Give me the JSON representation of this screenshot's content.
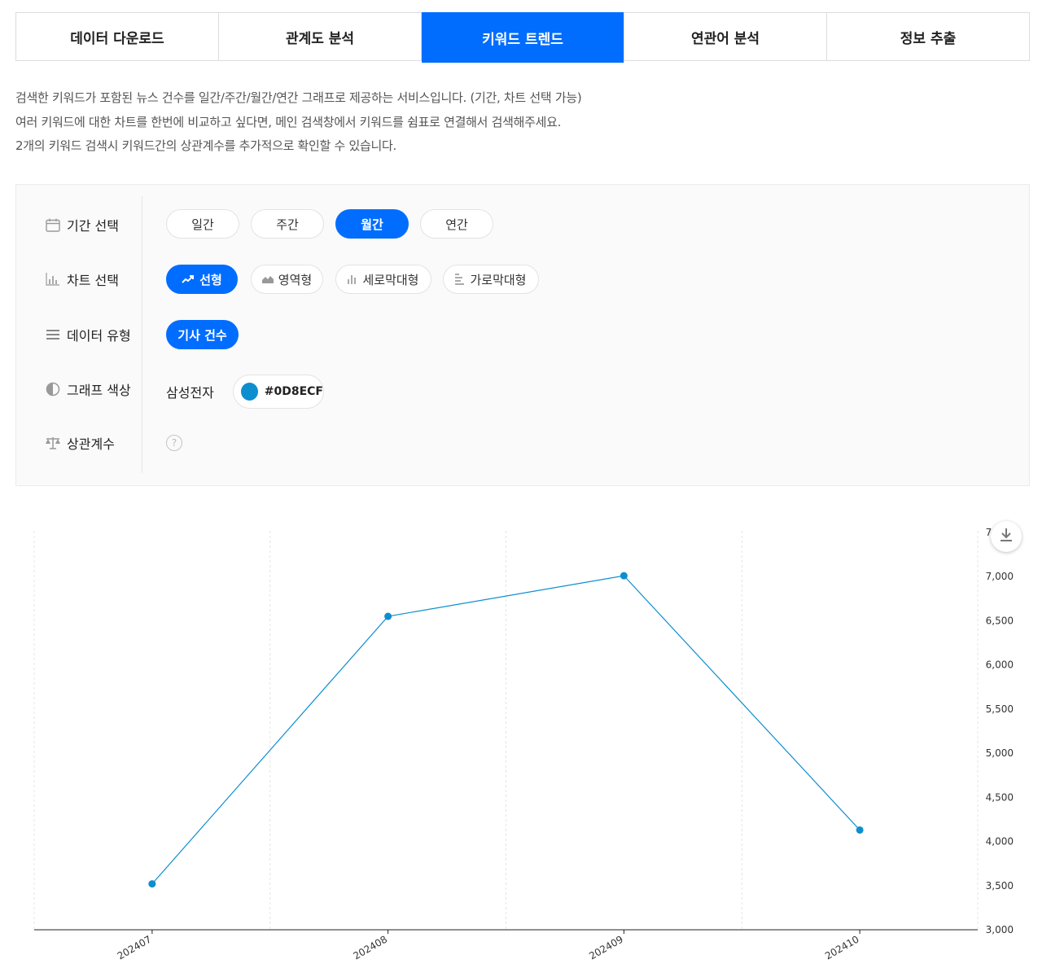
{
  "tabs": [
    {
      "label": "데이터 다운로드",
      "active": false
    },
    {
      "label": "관계도 분석",
      "active": false
    },
    {
      "label": "키워드 트렌드",
      "active": true
    },
    {
      "label": "연관어 분석",
      "active": false
    },
    {
      "label": "정보 추출",
      "active": false
    }
  ],
  "description": [
    "검색한 키워드가 포함된 뉴스 건수를 일간/주간/월간/연간 그래프로 제공하는 서비스입니다. (기간, 차트 선택 가능)",
    "여러 키워드에 대한 차트를 한번에 비교하고 싶다면, 메인 검색창에서 키워드를 쉼표로 연결해서 검색해주세요.",
    "2개의 키워드 검색시 키워드간의 상관계수를 추가적으로 확인할 수 있습니다."
  ],
  "options": {
    "period": {
      "label": "기간 선택",
      "items": [
        "일간",
        "주간",
        "월간",
        "연간"
      ],
      "selected": 2
    },
    "chart": {
      "label": "차트 선택",
      "items": [
        "선형",
        "영역형",
        "세로막대형",
        "가로막대형"
      ],
      "selected": 0
    },
    "data_type": {
      "label": "데이터 유형",
      "items": [
        "기사 건수"
      ],
      "selected": 0
    },
    "color": {
      "label": "그래프 색상",
      "keyword": "삼성전자",
      "hex": "#0D8ECF",
      "hex_label": "#0D8ECF"
    },
    "correlation": {
      "label": "상관계수",
      "help": "?"
    }
  },
  "colors": {
    "accent": "#006dff",
    "series": "#0D8ECF"
  },
  "chart_data": {
    "type": "line",
    "categories": [
      "202407",
      "202408",
      "202409",
      "202410"
    ],
    "series": [
      {
        "values": [
          3520,
          6550,
          7010,
          4130
        ]
      }
    ],
    "ylim": [
      3000,
      7500
    ],
    "yticks": [
      3000,
      3500,
      4000,
      4500,
      5000,
      5500,
      6000,
      6500,
      7000,
      7500
    ],
    "ytick_labels": [
      "3,000",
      "3,500",
      "4,000",
      "4,500",
      "5,000",
      "5,500",
      "6,000",
      "6,500",
      "7,000",
      "7,500"
    ],
    "grid": "vertical-dashed",
    "y_axis_position": "right"
  }
}
